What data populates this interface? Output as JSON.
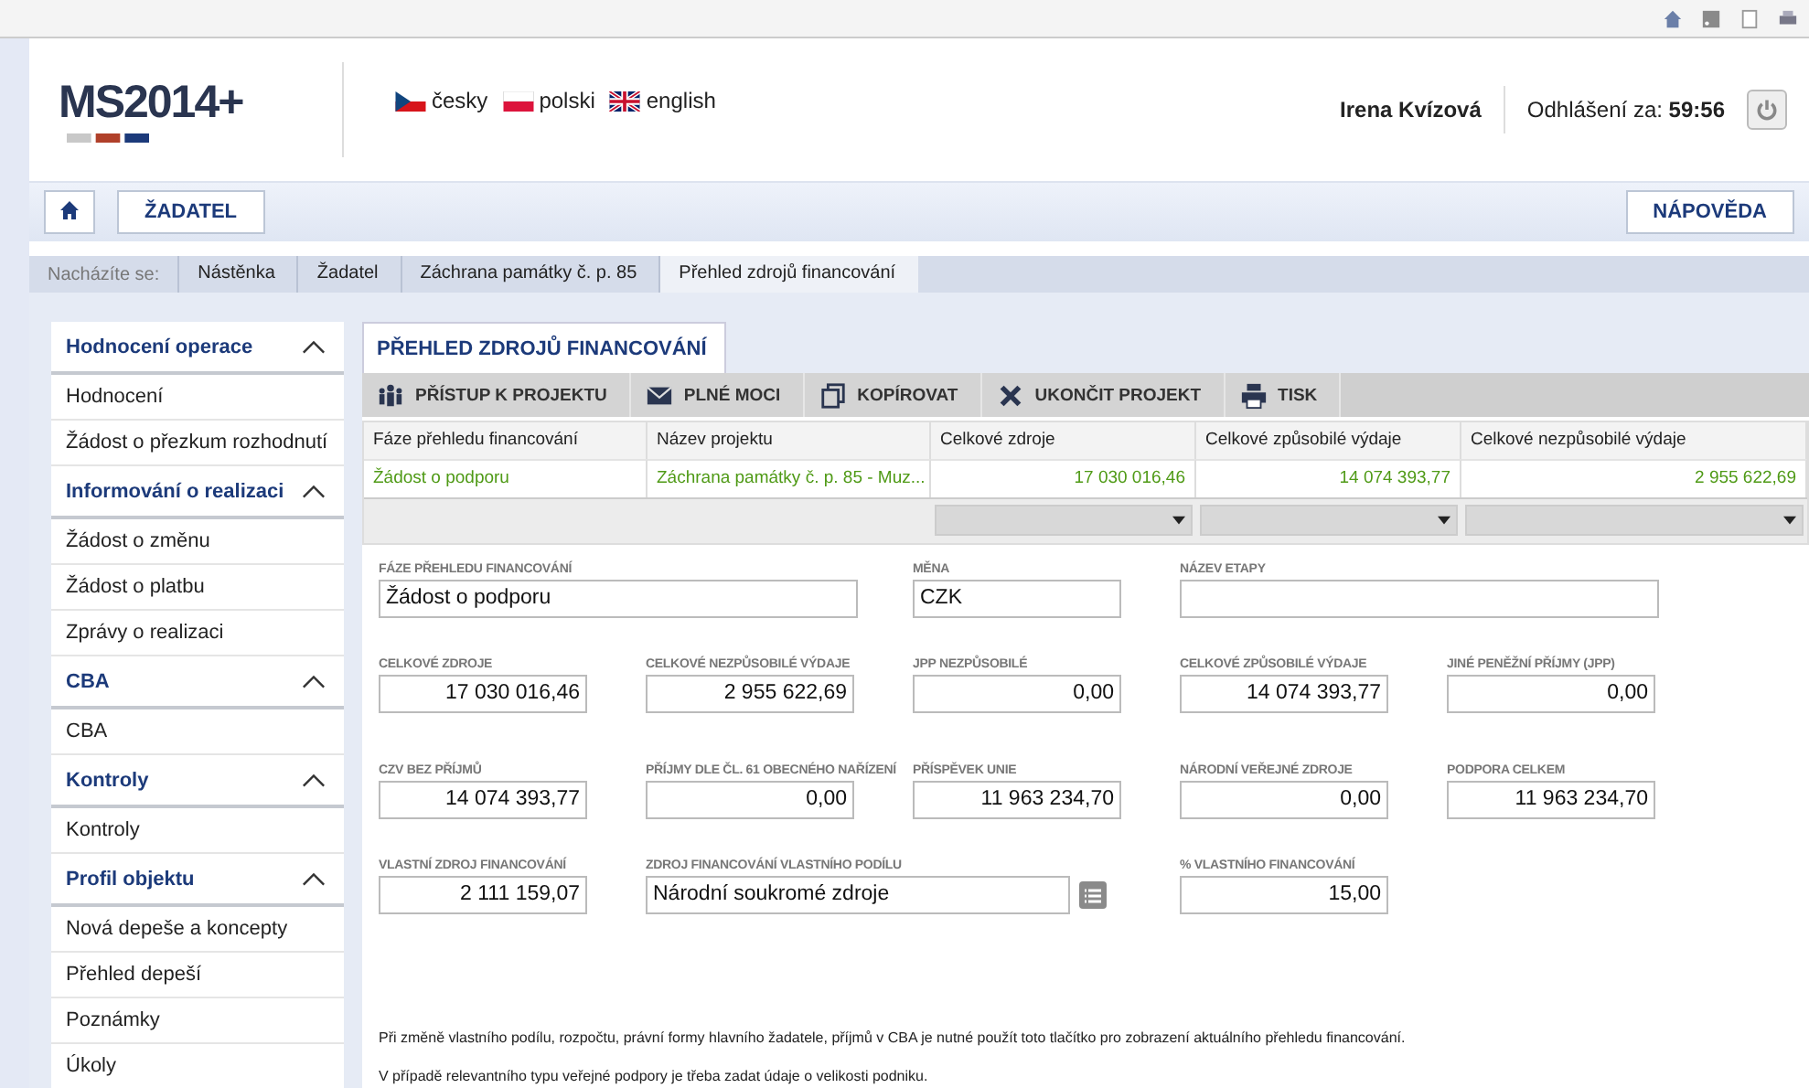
{
  "header": {
    "logo": "MS2014+",
    "languages": [
      {
        "label": "česky",
        "kind": "cz"
      },
      {
        "label": "polski",
        "kind": "pl"
      },
      {
        "label": "english",
        "kind": "gb"
      }
    ],
    "user": "Irena Kvízová",
    "logout_label": "Odhlášení za:",
    "logout_time": "59:56"
  },
  "toolbar": {
    "applicant_button": "ŽADATEL",
    "help_button": "NÁPOVĚDA"
  },
  "breadcrumb": {
    "label": "Nacházíte se:",
    "items": [
      "Nástěnka",
      "Žadatel",
      "Záchrana památky č. p. 85",
      "Přehled zdrojů financování"
    ]
  },
  "sidebar": {
    "groups": [
      {
        "title": "Hodnocení operace",
        "expanded": true,
        "items": [
          "Hodnocení",
          "Žádost o přezkum rozhodnutí"
        ]
      },
      {
        "title": "Informování o realizaci",
        "expanded": true,
        "items": [
          "Žádost o změnu",
          "Žádost o platbu",
          "Zprávy o realizaci"
        ]
      },
      {
        "title": "CBA",
        "expanded": true,
        "items": [
          "CBA"
        ]
      },
      {
        "title": "Kontroly",
        "expanded": true,
        "items": [
          "Kontroly"
        ]
      },
      {
        "title": "Profil objektu",
        "expanded": true,
        "items": [
          "Nová depeše a koncepty",
          "Přehled depeší",
          "Poznámky",
          "Úkoly"
        ]
      }
    ]
  },
  "panel": {
    "tab": "PŘEHLED ZDROJŮ FINANCOVÁNÍ",
    "actions": [
      {
        "label": "PŘÍSTUP K PROJEKTU",
        "kind": "people"
      },
      {
        "label": "PLNÉ MOCI",
        "kind": "mail"
      },
      {
        "label": "KOPÍROVAT",
        "kind": "copy"
      },
      {
        "label": "UKONČIT PROJEKT",
        "kind": "cross"
      },
      {
        "label": "TISK",
        "kind": "print"
      }
    ],
    "table": {
      "columns": [
        "Fáze přehledu financování",
        "Název projektu",
        "Celkové zdroje",
        "Celkové způsobilé výdaje",
        "Celkové nezpůsobilé výdaje"
      ],
      "rows": [
        {
          "cells": [
            "Žádost o podporu",
            "Záchrana památky č. p. 85 - Muz...",
            "17 030 016,46",
            "14 074 393,77",
            "2 955 622,69"
          ]
        }
      ],
      "filters": [
        {
          "kind": "none"
        },
        {
          "kind": "none"
        },
        {
          "kind": "dropdown"
        },
        {
          "kind": "dropdown"
        },
        {
          "kind": "dropdown"
        }
      ]
    },
    "form_rows": [
      [
        {
          "label": "FÁZE PŘEHLEDU FINANCOVÁNÍ",
          "value": "Žádost o podporu",
          "kind": "text"
        },
        {
          "label": "MĚNA",
          "value": "CZK",
          "kind": "code"
        },
        {
          "label": "NÁZEV ETAPY",
          "kind": "text"
        }
      ],
      [
        {
          "label": "CELKOVÉ ZDROJE",
          "value": "17 030 016,46",
          "kind": "amount"
        },
        {
          "label": "CELKOVÉ NEZPŮSOBILÉ VÝDAJE",
          "value": "2 955 622,69",
          "kind": "amount"
        },
        {
          "label": "JPP NEZPŮSOBILÉ",
          "value": "0,00",
          "kind": "amount"
        },
        {
          "label": "CELKOVÉ ZPŮSOBILÉ VÝDAJE",
          "value": "14 074 393,77",
          "kind": "amount"
        },
        {
          "label": "JINÉ PENĚŽNÍ PŘÍJMY (JPP)",
          "value": "0,00",
          "kind": "amount"
        }
      ],
      [
        {
          "label": "CZV BEZ PŘÍJMŮ",
          "value": "14 074 393,77",
          "kind": "amount"
        },
        {
          "label": "PŘÍJMY DLE ČL. 61 OBECNÉHO NAŘÍZENÍ",
          "value": "0,00",
          "kind": "amount"
        },
        {
          "label": "PŘÍSPĚVEK UNIE",
          "value": "11 963 234,70",
          "kind": "amount"
        },
        {
          "label": "NÁRODNÍ VEŘEJNÉ ZDROJE",
          "value": "0,00",
          "kind": "amount"
        },
        {
          "label": "PODPORA CELKEM",
          "value": "11 963 234,70",
          "kind": "amount"
        }
      ],
      [
        {
          "label": "VLASTNÍ ZDROJ FINANCOVÁNÍ",
          "value": "2 111 159,07",
          "kind": "amount"
        },
        {
          "label": "ZDROJ FINANCOVÁNÍ VLASTNÍHO PODÍLU",
          "value": "Národní soukromé zdroje",
          "kind": "lookup"
        },
        {
          "label": "% VLASTNÍHO FINANCOVÁNÍ",
          "value": "15,00",
          "kind": "amount"
        }
      ]
    ],
    "notes": [
      "Při změně vlastního podílu, rozpočtu, právní formy hlavního žadatele, příjmů v CBA je nutné použít toto tlačítko pro zobrazení aktuálního přehledu financování.",
      "V případě relevantního typu veřejné podpory je třeba zadat údaje o velikosti podniku."
    ]
  }
}
